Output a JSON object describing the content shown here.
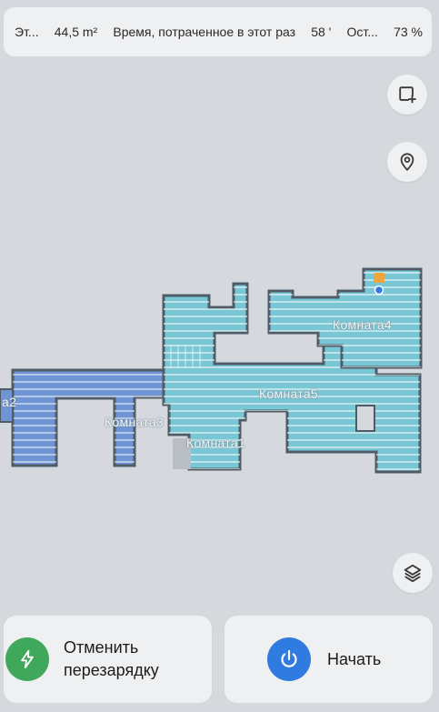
{
  "status": {
    "floor_label": "Эт...",
    "area": "44,5 m²",
    "time_label": "Время, потраченное в этот раз",
    "time_value": "58 '",
    "battery_label": "Ост...",
    "battery_value": "73 %"
  },
  "map": {
    "rooms": {
      "room1": "Комната1",
      "room2": "а2",
      "room3": "Комната3",
      "room4": "Комната4",
      "room5": "Комната5"
    },
    "icons": [
      "edit-area-icon",
      "location-pin-icon",
      "layers-icon"
    ],
    "colors": {
      "teal_room": "#79c7d5",
      "blue_room": "#6f95d4",
      "path": "#ffffff",
      "wall": "#4f5c68",
      "background": "#d5d9dd"
    }
  },
  "actions": {
    "cancel_recharge_line1": "Отменить",
    "cancel_recharge_line2": "перезарядку",
    "start_label": "Начать",
    "cancel_icon_color": "#3fa85a",
    "start_icon_color": "#2f7be0"
  }
}
